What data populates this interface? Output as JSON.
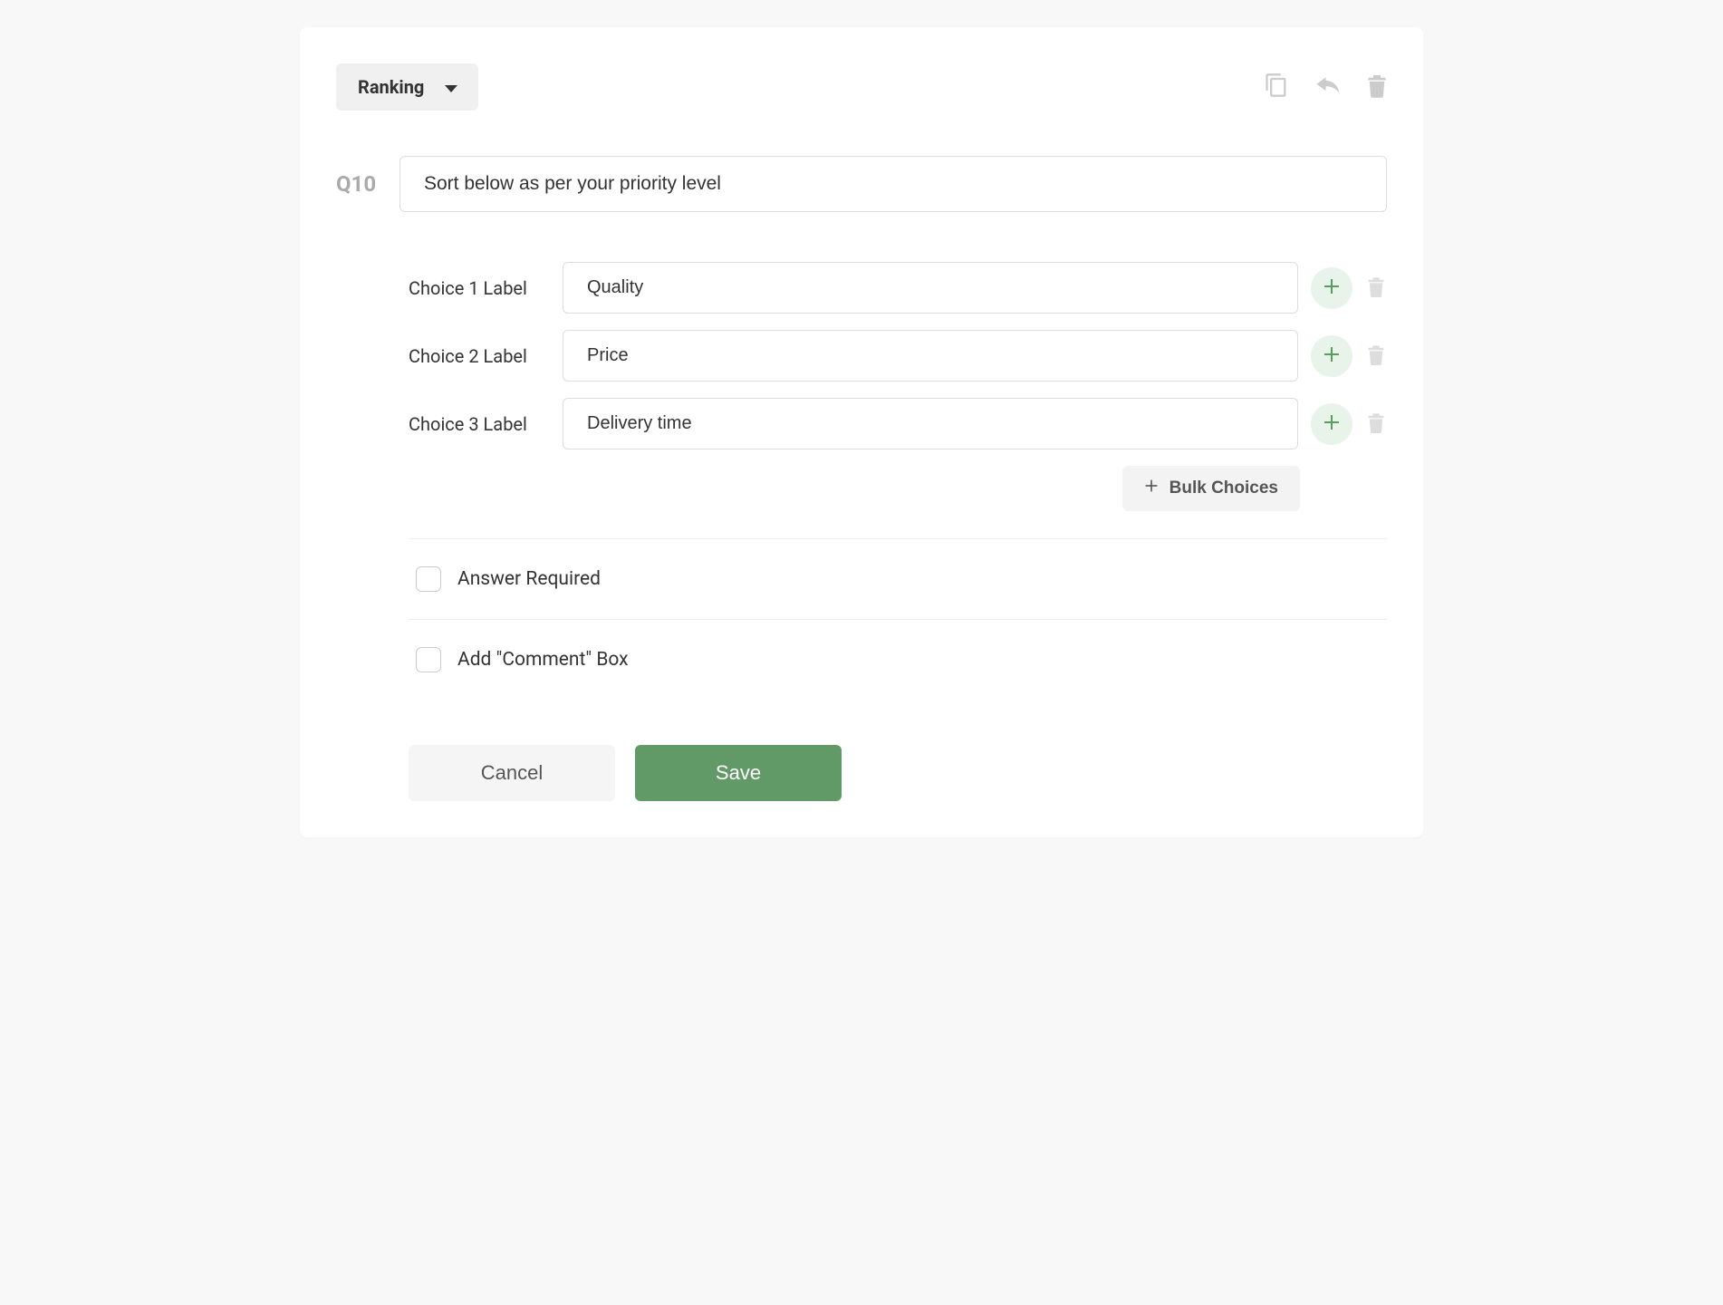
{
  "header": {
    "question_type": "Ranking"
  },
  "question": {
    "number_label": "Q10",
    "text": "Sort below as per your priority level"
  },
  "choices": [
    {
      "label": "Choice 1 Label",
      "value": "Quality"
    },
    {
      "label": "Choice 2 Label",
      "value": "Price"
    },
    {
      "label": "Choice 3 Label",
      "value": "Delivery time"
    }
  ],
  "bulk_choices_label": "Bulk Choices",
  "options": {
    "answer_required_label": "Answer Required",
    "add_comment_label": "Add \"Comment\" Box"
  },
  "buttons": {
    "cancel": "Cancel",
    "save": "Save"
  }
}
